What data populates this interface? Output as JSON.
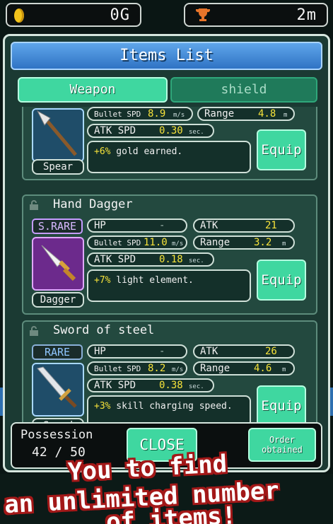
{
  "hud": {
    "gold": "0G",
    "distance": "2m",
    "icons": {
      "gold": "coin-icon",
      "distance": "trophy-icon"
    }
  },
  "panel": {
    "title": "Items List",
    "tabs": [
      {
        "label": "Weapon",
        "active": true
      },
      {
        "label": "shield",
        "active": false
      }
    ]
  },
  "items": [
    {
      "name": "",
      "rarity": "",
      "type": "Spear",
      "icon": "spear-icon",
      "stats": {
        "bullet_spd_label": "Bullet SPD",
        "bullet_spd": "8.9",
        "bullet_spd_unit": "m/s",
        "range_label": "Range",
        "range": "4.8",
        "range_unit": "m",
        "atk_spd_label": "ATK SPD",
        "atk_spd": "0.30",
        "atk_spd_unit": "sec."
      },
      "effect_pct": "+6%",
      "effect_text": " gold earned.",
      "equip_label": "Equip"
    },
    {
      "name": "Hand Dagger",
      "rarity": "S.RARE",
      "type": "Dagger",
      "icon": "dagger-icon",
      "stats": {
        "hp_label": "HP",
        "hp": "-",
        "atk_label": "ATK",
        "atk": "21",
        "bullet_spd_label": "Bullet SPD",
        "bullet_spd": "11.0",
        "bullet_spd_unit": "m/s",
        "range_label": "Range",
        "range": "3.2",
        "range_unit": "m",
        "atk_spd_label": "ATK SPD",
        "atk_spd": "0.18",
        "atk_spd_unit": "sec."
      },
      "effect_pct": "+7%",
      "effect_text": " light element.",
      "equip_label": "Equip"
    },
    {
      "name": "Sword of steel",
      "rarity": "RARE",
      "type": "Sword",
      "icon": "sword-icon",
      "stats": {
        "hp_label": "HP",
        "hp": "-",
        "atk_label": "ATK",
        "atk": "26",
        "bullet_spd_label": "Bullet SPD",
        "bullet_spd": "8.2",
        "bullet_spd_unit": "m/s",
        "range_label": "Range",
        "range": "4.6",
        "range_unit": "m",
        "atk_spd_label": "ATK SPD",
        "atk_spd": "0.38",
        "atk_spd_unit": "sec."
      },
      "effect_pct": "+3%",
      "effect_text": " skill charging speed.",
      "equip_label": "Equip"
    }
  ],
  "footer": {
    "possession_label": "Possession",
    "possession_count": "42 / 50",
    "close_label": "CLOSE",
    "order_label_line1": "Order",
    "order_label_line2": "obtained"
  },
  "promo": {
    "line1": "You to find",
    "line2": "an unlimited number",
    "line3": "of items!"
  },
  "colors": {
    "accent_green": "#3fd7a0",
    "title_blue": "#2f73c4",
    "value_yellow": "#f6e23a",
    "srare_purple": "#c59cff",
    "rare_blue": "#8fc6ff",
    "promo_red": "#a31818"
  }
}
